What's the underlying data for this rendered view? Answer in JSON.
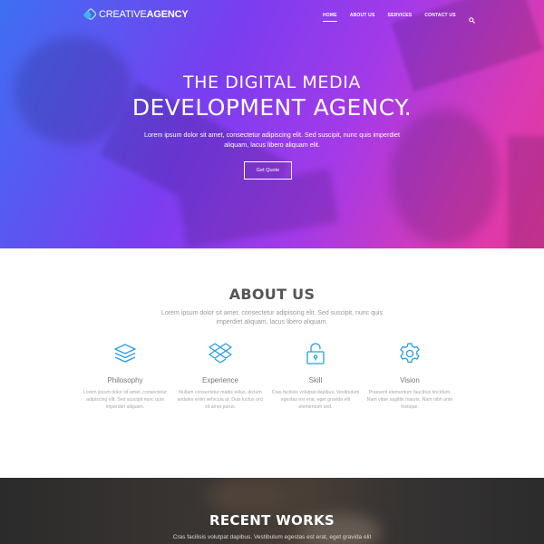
{
  "brand": {
    "logo_light": "CREATIVE",
    "logo_bold": "AGENCY"
  },
  "nav": {
    "items": [
      {
        "label": "HOME",
        "active": true
      },
      {
        "label": "ABOUT US"
      },
      {
        "label": "SERVICES"
      },
      {
        "label": "CONTACT US"
      }
    ]
  },
  "hero": {
    "title_line1": "THE DIGITAL MEDIA",
    "title_line2": "DEVELOPMENT AGENCY.",
    "subtitle": "Lorem ipsum dolor sit amet, consectetur adipiscing elit. Sed suscipit, nunc quis imperdiet aliquam, lacus libero aliquam elit.",
    "button": "Get Quote"
  },
  "about": {
    "title": "ABOUT US",
    "subtitle": "Lorem ipsum dolor sit amet, consectetur adipiscing elit. Sed suscipit, nunc quis imperdiet aliquam, lacus libero aliquam.",
    "features": [
      {
        "icon": "layers-icon",
        "name": "Philosophy",
        "text": "Lorem ipsum dolor sit amet, consectetur adipiscing elit. Sed suscipit nunc quis imperdiet aliquam."
      },
      {
        "icon": "dropbox-icon",
        "name": "Experience",
        "text": "Nullam consectetur mattis tellus, dictum sodales enim vehicula at. Duis luctus orci sit amet purus."
      },
      {
        "icon": "lock-icon",
        "name": "Skill",
        "text": "Cras facilisis volutpat dapibus. Vestibulum egestas est erat, eget gravida elit elementum sed."
      },
      {
        "icon": "gear-icon",
        "name": "Vision",
        "text": "Praesent elementum faucibus tincidunt. Nam vitae sagittis mauris. Nam nibh ante tristique."
      }
    ]
  },
  "works": {
    "title": "RECENT WORKS",
    "subtitle": "Cras facilisis volutpat dapibus. Vestibulum egestas est erat, eget gravida elit"
  },
  "colors": {
    "accent": "#2a9de0",
    "gradient_start": "#3d6ff2",
    "gradient_end": "#e8379a"
  }
}
